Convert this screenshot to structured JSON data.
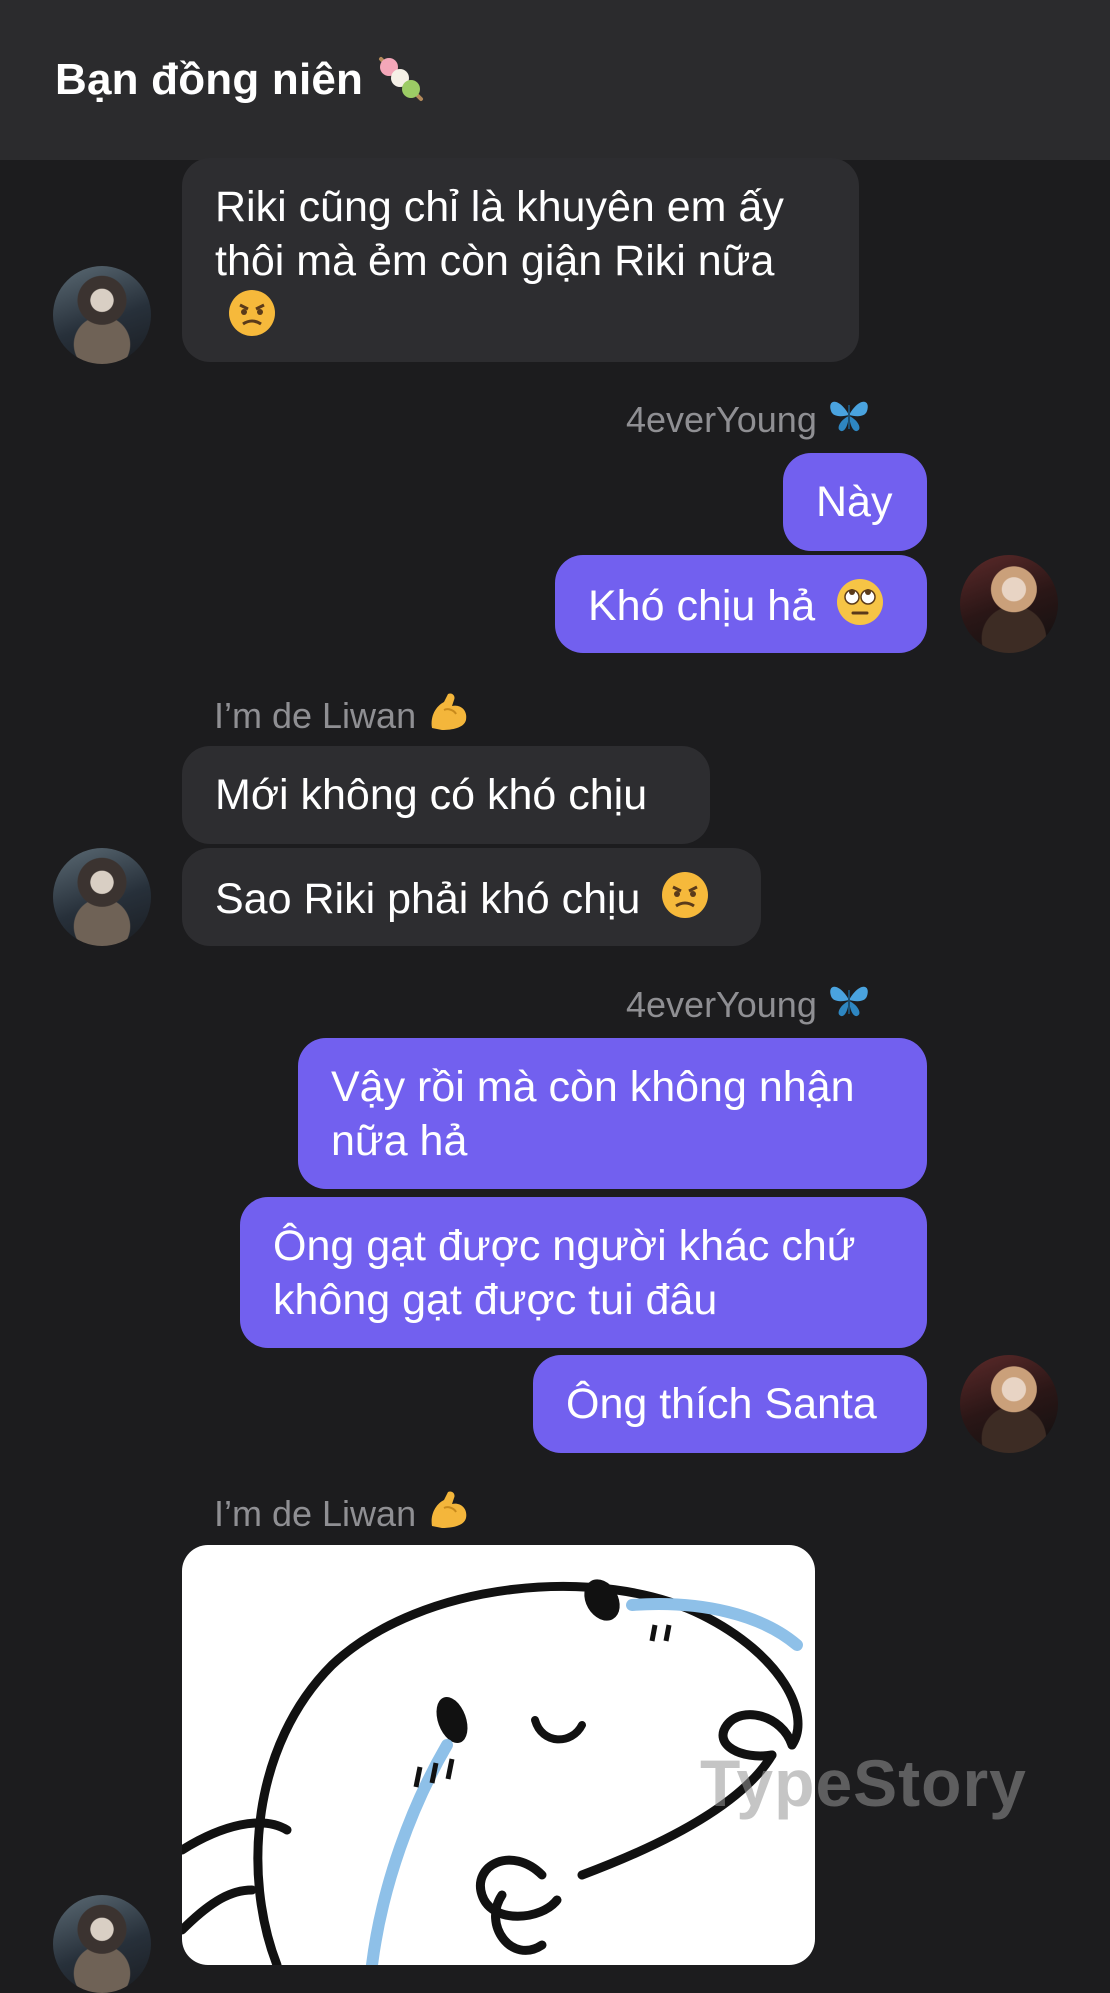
{
  "header": {
    "title": "Bạn đồng niên",
    "title_emoji": "dango-icon"
  },
  "senders": {
    "me": "4everYoung",
    "me_emoji": "butterfly-icon",
    "friend": "I’m de Liwan",
    "friend_emoji": "flexed-biceps-icon"
  },
  "messages": [
    {
      "from": "friend",
      "text": "Riki cũng chỉ là khuyên em ấy thôi mà ẻm còn giận Riki nữa",
      "emoji": "angry-face-icon"
    },
    {
      "from": "me",
      "text": "Này"
    },
    {
      "from": "me",
      "text": "Khó chịu hả",
      "emoji": "eye-roll-face-icon"
    },
    {
      "from": "friend",
      "text": "Mới không có khó chịu"
    },
    {
      "from": "friend",
      "text": "Sao Riki phải khó chịu",
      "emoji": "angry-face-icon"
    },
    {
      "from": "me",
      "text": "Vậy rồi mà còn không nhận nữa hả"
    },
    {
      "from": "me",
      "text": "Ông gạt được người khác chứ không gạt được tui đâu"
    },
    {
      "from": "me",
      "text": "Ông thích Santa"
    }
  ],
  "sticker": "crying-blob-sticker",
  "watermark": "TypeStory",
  "colors": {
    "background": "#1c1c1e",
    "header": "#2b2b2d",
    "incoming_bubble": "#2d2d30",
    "outgoing_bubble": "#7260ef",
    "sender_text": "#8f8f93"
  }
}
